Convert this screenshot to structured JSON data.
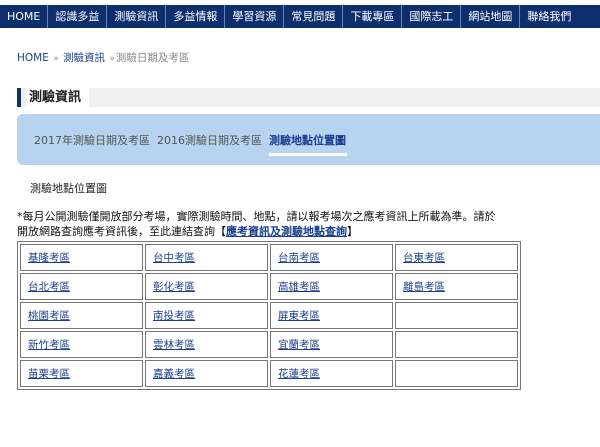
{
  "nav": [
    "HOME",
    "認識多益",
    "測驗資訊",
    "多益情報",
    "學習資源",
    "常見問題",
    "下載專區",
    "國際志工",
    "網站地圖",
    "聯絡我們"
  ],
  "breadcrumb": {
    "home": "HOME",
    "sep": "»",
    "section": "測驗資訊",
    "current": "測驗日期及考區"
  },
  "section_title": "測驗資訊",
  "tabs": [
    {
      "label": "2017年測驗日期及考區"
    },
    {
      "label": "2016測驗日期及考區"
    },
    {
      "label": "測驗地點位置圖"
    }
  ],
  "subheading": "測驗地點位置圖",
  "notice": {
    "text_line1": "*每月公開測驗僅開放部分考場，實際測驗時間、地點，請以報考場次之應考資訊上所載為準。請於",
    "text_line2": "開放網路查詢應考資訊後，至此連結查詢【",
    "link": "應考資訊及測驗地點查詢",
    "close": "】"
  },
  "areas": [
    [
      "基隆考區",
      "台中考區",
      "台南考區",
      "台東考區"
    ],
    [
      "台北考區",
      "彰化考區",
      "高雄考區",
      "離島考區"
    ],
    [
      "桃園考區",
      "南投考區",
      "屏東考區",
      ""
    ],
    [
      "新竹考區",
      "雲林考區",
      "宜蘭考區",
      ""
    ],
    [
      "苗栗考區",
      "嘉義考區",
      "花蓮考區",
      ""
    ]
  ]
}
